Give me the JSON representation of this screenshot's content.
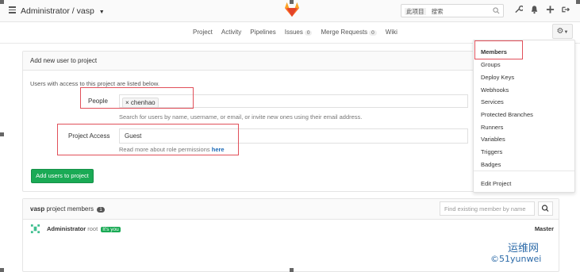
{
  "header": {
    "breadcrumb": "Administrator / vasp",
    "search_scope": "此项目",
    "search_placeholder": "搜索"
  },
  "nav": {
    "links": [
      "Project",
      "Activity",
      "Pipelines",
      "Issues",
      "Merge Requests",
      "Wiki"
    ],
    "issues_count": "0",
    "mr_count": "0"
  },
  "add_user": {
    "panel_title": "Add new user to project",
    "intro": "Users with access to this project are listed below.",
    "people_label": "People",
    "people_chip": "chenhao",
    "people_hint": "Search for users by name, username, or email, or invite new ones using their email address.",
    "access_label": "Project Access",
    "access_value": "Guest",
    "access_hint": "Read more about role permissions",
    "access_hint_link": "here",
    "button": "Add users to project"
  },
  "members": {
    "title_project": "vasp",
    "title_rest": "project members",
    "count": "1",
    "search_placeholder": "Find existing member by name",
    "rows": [
      {
        "name": "Administrator",
        "username": "root",
        "badge": "It's you",
        "role": "Master"
      }
    ]
  },
  "settings_menu": {
    "items": [
      "Members",
      "Groups",
      "Deploy Keys",
      "Webhooks",
      "Services",
      "Protected Branches",
      "Runners",
      "Variables",
      "Triggers",
      "Badges",
      "Edit Project"
    ]
  },
  "watermark": {
    "line1": "运维网",
    "line2": "©51yunwei"
  },
  "colors": {
    "accent_green": "#1aaa55",
    "highlight_red": "#e1505a",
    "link_blue": "#1b69b6"
  }
}
